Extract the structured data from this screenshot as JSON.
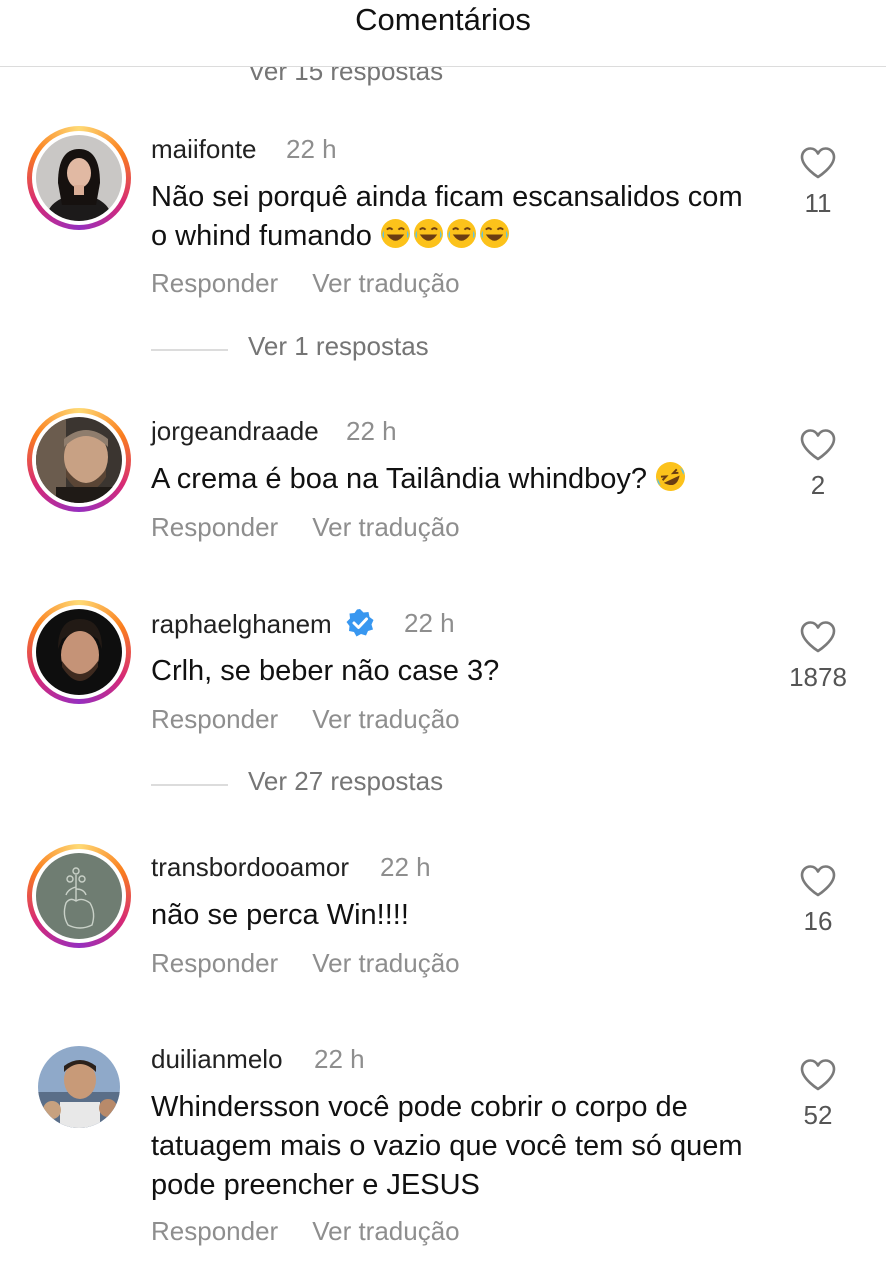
{
  "header": {
    "title": "Comentários"
  },
  "clipped_reply_text": "Ver 15 respostas",
  "actions": {
    "reply": "Responder",
    "translate": "Ver tradução"
  },
  "comments": [
    {
      "username": "maiifonte",
      "time": "22 h",
      "text": "Não sei porquê ainda ficam escansalidos com o whind fumando",
      "emoji": "😂😂😂😂",
      "likes": "11",
      "replies_text": "Ver 1 respostas"
    },
    {
      "username": "jorgeandraade",
      "time": "22 h",
      "text": "A crema é boa na Tailândia whindboy?",
      "emoji": "🤣",
      "likes": "2"
    },
    {
      "username": "raphaelghanem",
      "time": "22 h",
      "verified": true,
      "text": "Crlh, se beber não case 3?",
      "likes": "1878",
      "replies_text": "Ver 27 respostas"
    },
    {
      "username": "transbordooamor",
      "time": "22 h",
      "text": "não se perca Win!!!!",
      "likes": "16"
    },
    {
      "username": "duilianmelo",
      "time": "22 h",
      "text": "Whindersson você pode cobrir o corpo de tatuagem mais o vazio que você tem só quem pode preencher e JESUS",
      "likes": "52"
    }
  ],
  "colors": {
    "accent_verified": "#3897f0",
    "muted_text": "#8e8e8e",
    "story_ring": [
      "#feda75",
      "#fa7e1e",
      "#d62976",
      "#962fbf"
    ]
  }
}
